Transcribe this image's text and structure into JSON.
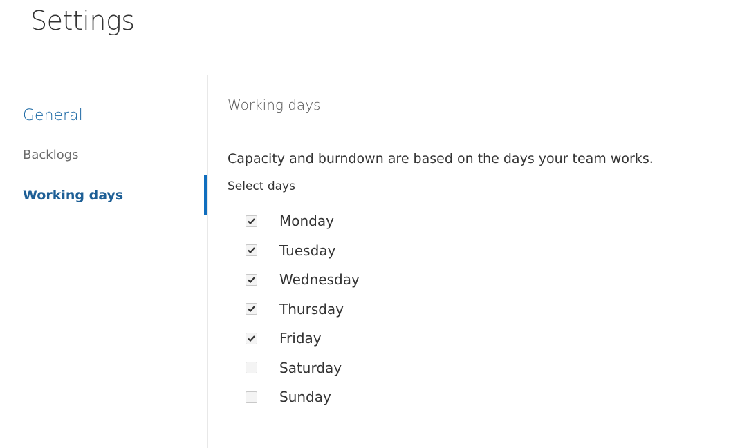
{
  "page": {
    "title": "Settings"
  },
  "sidebar": {
    "items": [
      {
        "label": "General",
        "active": false
      },
      {
        "label": "Backlogs",
        "active": false
      },
      {
        "label": "Working days",
        "active": true
      }
    ]
  },
  "main": {
    "section_title": "Working days",
    "description": "Capacity and burndown are based on the days your team works.",
    "select_label": "Select days",
    "days": [
      {
        "label": "Monday",
        "checked": true
      },
      {
        "label": "Tuesday",
        "checked": true
      },
      {
        "label": "Wednesday",
        "checked": true
      },
      {
        "label": "Thursday",
        "checked": true
      },
      {
        "label": "Friday",
        "checked": true
      },
      {
        "label": "Saturday",
        "checked": false
      },
      {
        "label": "Sunday",
        "checked": false
      }
    ]
  },
  "colors": {
    "accent": "#106ebe",
    "link": "#1e6aa5"
  }
}
